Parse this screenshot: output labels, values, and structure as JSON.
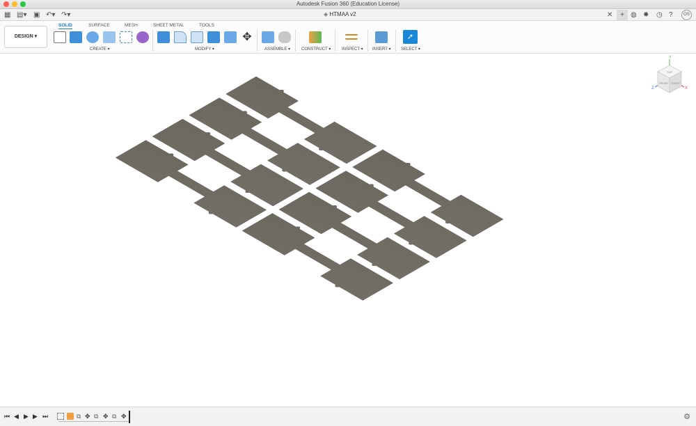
{
  "window": {
    "title": "Autodesk Fusion 360 (Education License)"
  },
  "document": {
    "tab_label": "HTMAA v2",
    "user_initials": "OS"
  },
  "workspace": {
    "label": "DESIGN ▾"
  },
  "ribbon": {
    "tabs": [
      "SOLID",
      "SURFACE",
      "MESH",
      "SHEET METAL",
      "TOOLS"
    ],
    "active_tab": "SOLID",
    "groups": [
      "CREATE ▾",
      "MODIFY ▾",
      "ASSEMBLE ▾",
      "CONSTRUCT ▾",
      "INSPECT ▾",
      "INSERT ▾",
      "SELECT ▾"
    ]
  },
  "viewcube": {
    "axis_labels": [
      "Y",
      "Z",
      "X"
    ],
    "faces": [
      "TOP",
      "FRONT",
      "RIGHT"
    ]
  },
  "colors": {
    "part": "#706c62",
    "accent": "#1a7dc4",
    "close": "#ff5f57",
    "minimize": "#febc2e",
    "zoom": "#28c840"
  },
  "icons": [
    "grid-icon",
    "file-icon",
    "save-icon",
    "undo-icon",
    "redo-icon",
    "gear-icon",
    "play-icon",
    "timeline-marker-icon"
  ]
}
